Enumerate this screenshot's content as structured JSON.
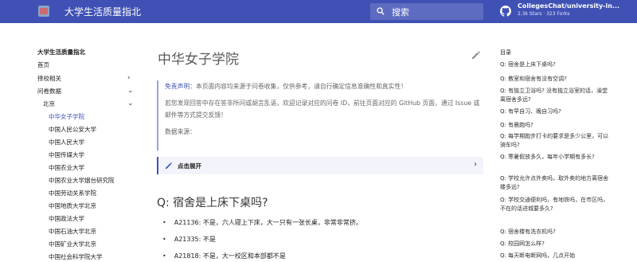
{
  "header": {
    "site_title": "大学生活质量指北",
    "search_placeholder": "搜索",
    "repo_name": "CollegesChat/university-in...",
    "repo_stats": "2.3k Stars · 323 Forks"
  },
  "sidebar": {
    "title": "大学生活质量指北",
    "items": [
      {
        "label": "首页"
      },
      {
        "label": "择校相关"
      },
      {
        "label": "问卷数据"
      },
      {
        "label": "北京"
      },
      {
        "label": "中华女子学院"
      },
      {
        "label": "中国人民公安大学"
      },
      {
        "label": "中国人民大学"
      },
      {
        "label": "中国传媒大学"
      },
      {
        "label": "中国农业大学"
      },
      {
        "label": "中国农业大学烟台研究院"
      },
      {
        "label": "中国劳动关系学院"
      },
      {
        "label": "中国地质大学北京"
      },
      {
        "label": "中国政法大学"
      },
      {
        "label": "中国石油大学北京"
      },
      {
        "label": "中国矿业大学北京"
      },
      {
        "label": "中国社会科学院大学"
      }
    ]
  },
  "main": {
    "title": "中华女子学院",
    "notice": {
      "disclaimer_label": "免责声明",
      "disclaimer_text": "：本页面内容均来源于问卷收集，仅供参考，请自行确定信息准确性和真实性！",
      "report_text": "若您发现回答中存在答非所问或胡言乱语，欢迎记录对应的问卷 ID，前往页面对应的 GitHub 页面，通过 Issue 或邮件等方式提交反馈！",
      "source_text": "数据来源："
    },
    "collapse_label": "点击展开",
    "question": "Q: 宿舍是上床下桌吗?",
    "answers": [
      "A21136: 不是，六人寝上下床，大一只有一张长桌，非常非常挤。",
      "A21335: 不是",
      "A21818: 不是，大一校区和本部都不是"
    ]
  },
  "toc": {
    "title": "目录",
    "items": [
      "Q: 宿舍是上床下桌吗?",
      "Q: 教室和宿舍有没有空调?",
      "Q: 有独立卫浴吗? 没有独立浴室的话，澡堂离宿舍多远?",
      "Q: 有早自习、晚自习吗?",
      "Q: 有晨跑吗?",
      "Q: 每学期跑步打卡的要求是多少公里，可以骑车吗?",
      "Q: 寒暑假放多久，每年小学期有多长?",
      "Q: 学校允许点外卖吗，取外卖的地方离宿舍楼多远?",
      "Q: 学校交通便利吗，有地铁吗，在市区吗，不在的话进城要多久?",
      "Q: 宿舍楼有洗衣机吗?",
      "Q: 校园网怎么样?",
      "Q: 每天断电断网吗，几点开始"
    ]
  },
  "colors": {
    "primary": "#4051b5",
    "search_bg": "#5d6cc0"
  }
}
